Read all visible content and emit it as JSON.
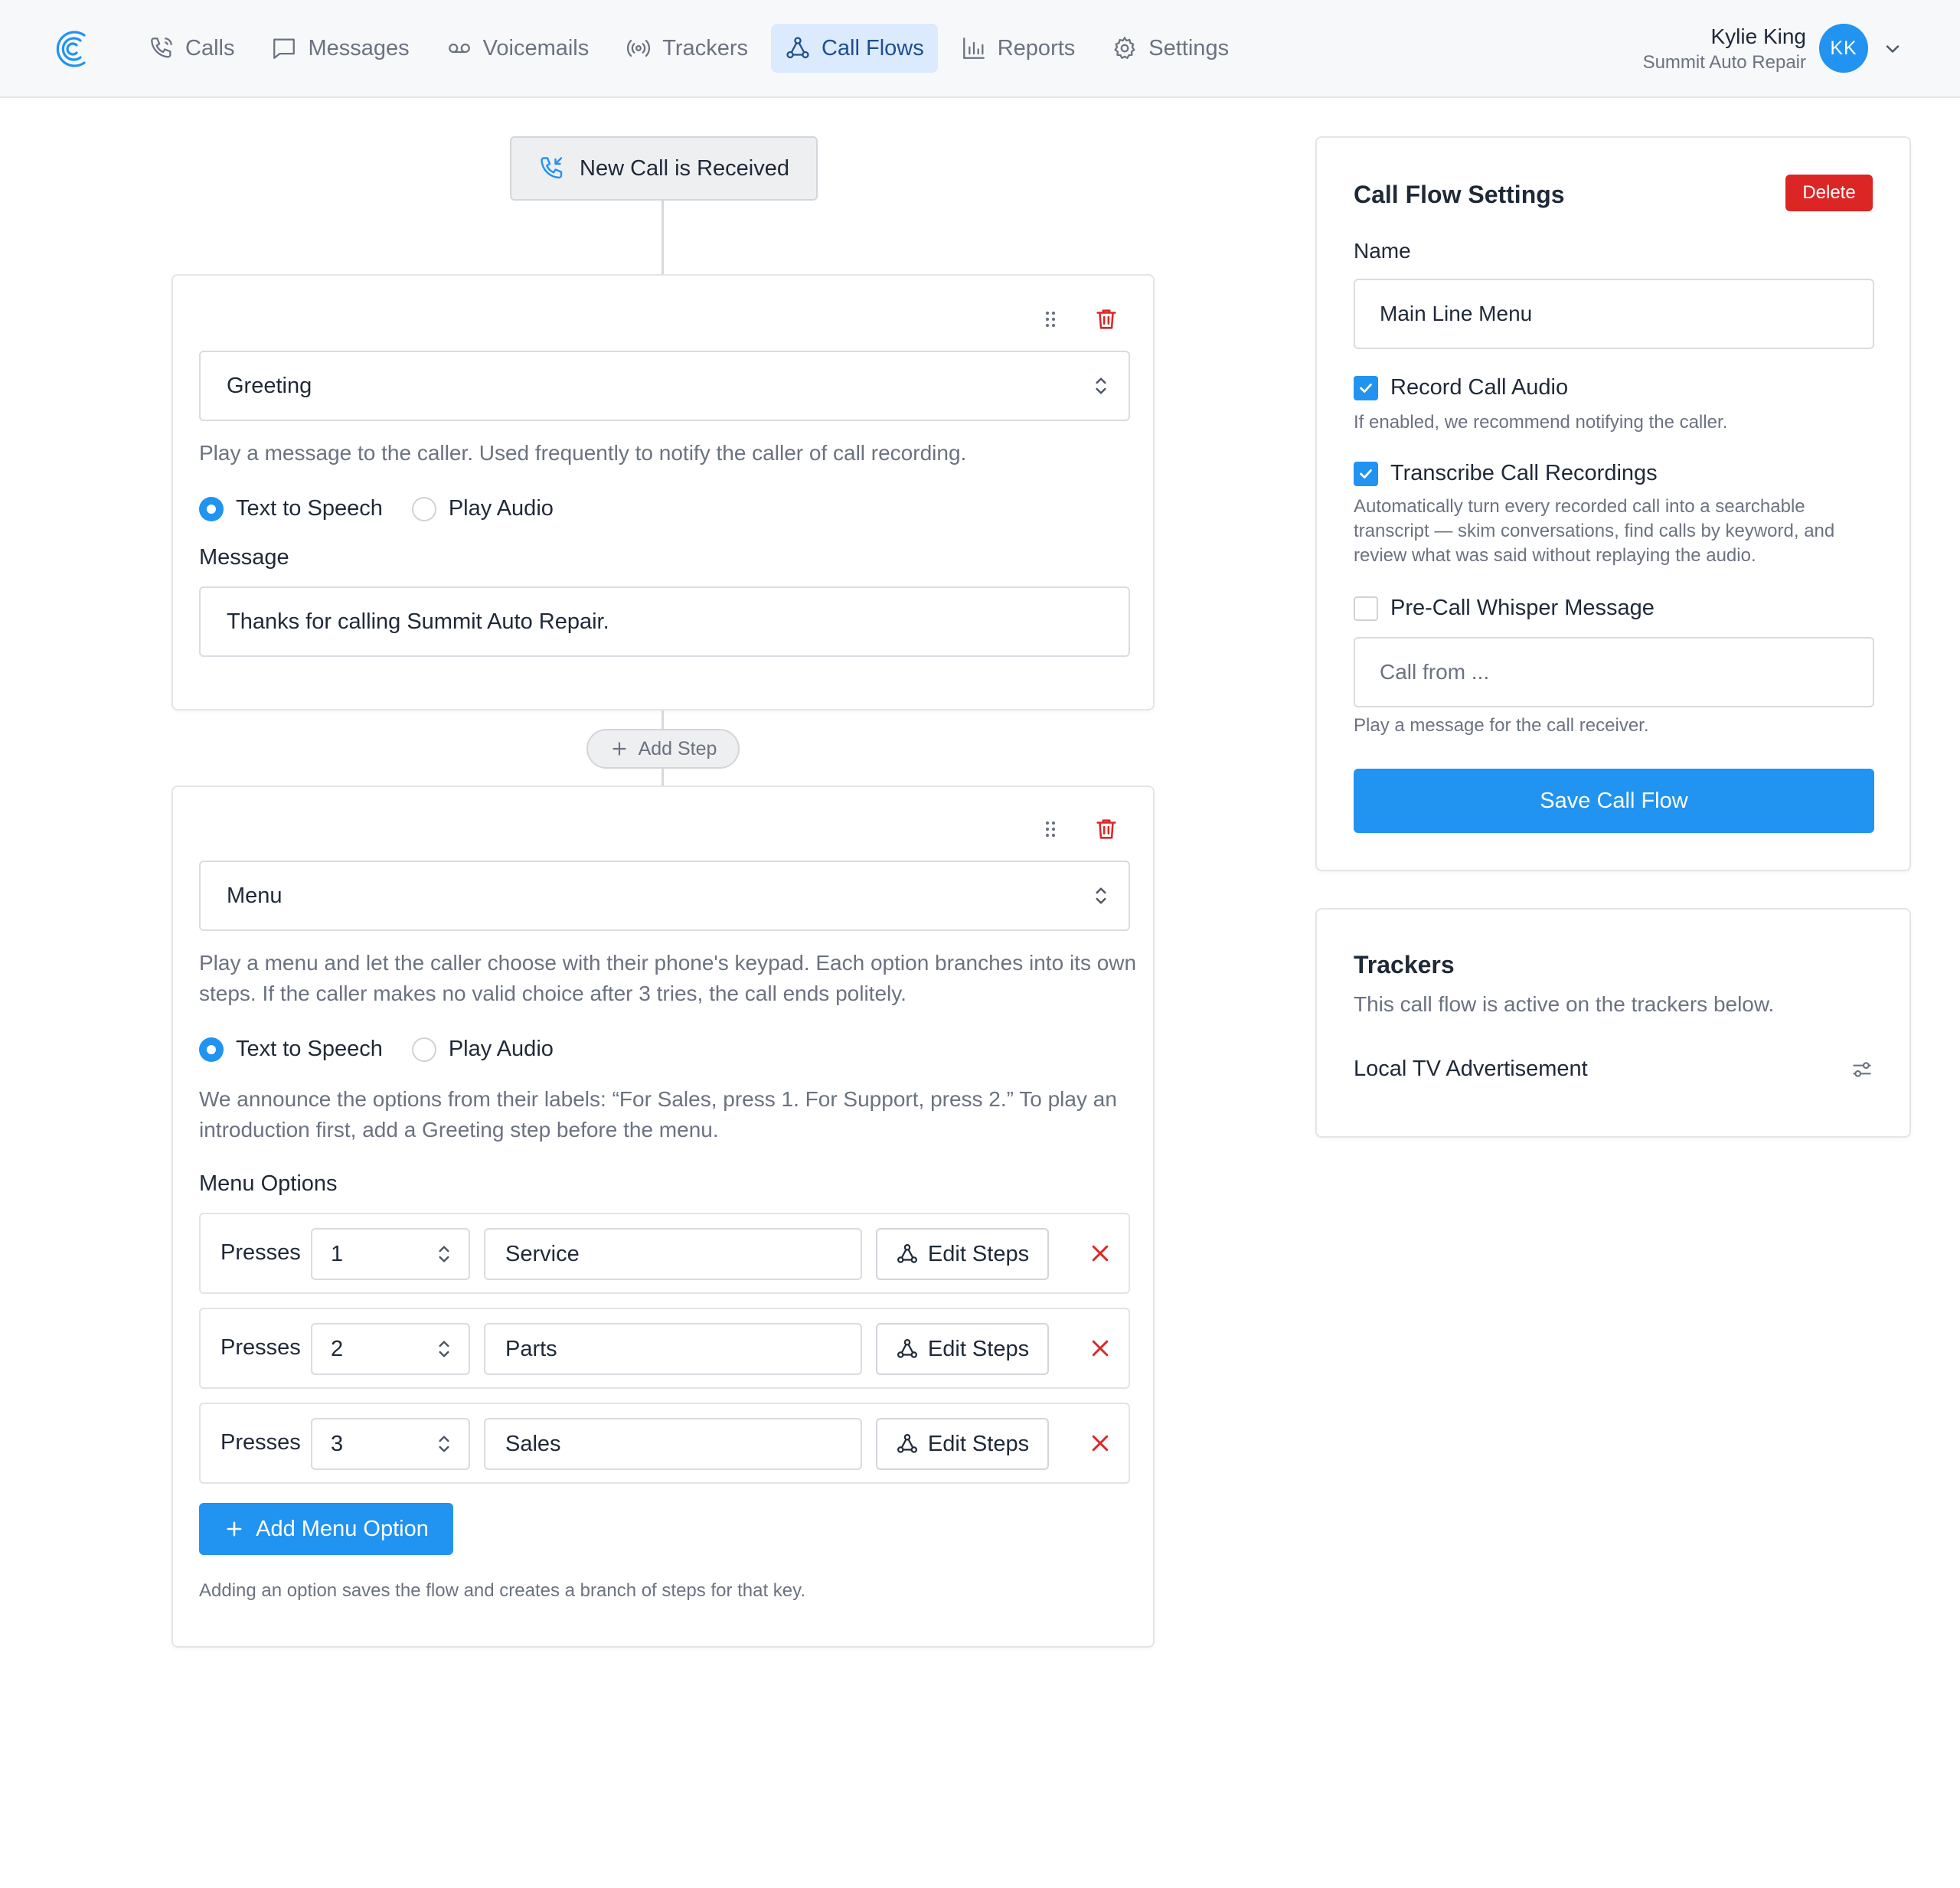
{
  "header": {
    "nav": [
      {
        "label": "Calls",
        "icon": "phone-icon"
      },
      {
        "label": "Messages",
        "icon": "message-icon"
      },
      {
        "label": "Voicemails",
        "icon": "voicemail-icon"
      },
      {
        "label": "Trackers",
        "icon": "broadcast-icon"
      },
      {
        "label": "Call Flows",
        "icon": "flow-icon",
        "active": true
      },
      {
        "label": "Reports",
        "icon": "bar-chart-icon"
      },
      {
        "label": "Settings",
        "icon": "gear-icon"
      }
    ],
    "user": {
      "name": "Kylie King",
      "company": "Summit Auto Repair",
      "initials": "KK"
    }
  },
  "flow": {
    "start_node": "New Call is Received",
    "greeting_step": {
      "type": "Greeting",
      "description": "Play a message to the caller. Used frequently to notify the caller of call recording.",
      "radio_tts": "Text to Speech",
      "radio_audio": "Play Audio",
      "selected": "tts",
      "message_label": "Message",
      "message_value": "Thanks for calling Summit Auto Repair."
    },
    "add_step_label": "Add Step",
    "menu_step": {
      "type": "Menu",
      "description": "Play a menu and let the caller choose with their phone's keypad. Each option branches into its own steps. If the caller makes no valid choice after 3 tries, the call ends politely.",
      "radio_tts": "Text to Speech",
      "radio_audio": "Play Audio",
      "selected": "tts",
      "announce_help": "We announce the options from their labels: “For Sales, press 1. For Support, press 2.” To play an introduction first, add a Greeting step before the menu.",
      "options_label": "Menu Options",
      "presses_label": "Presses",
      "edit_steps_label": "Edit Steps",
      "options": [
        {
          "key": "1",
          "label": "Service"
        },
        {
          "key": "2",
          "label": "Parts"
        },
        {
          "key": "3",
          "label": "Sales"
        }
      ],
      "add_option_label": "Add Menu Option",
      "add_option_help": "Adding an option saves the flow and creates a branch of steps for that key."
    }
  },
  "settings": {
    "title": "Call Flow Settings",
    "delete_label": "Delete",
    "name_label": "Name",
    "name_value": "Main Line Menu",
    "record": {
      "label": "Record Call Audio",
      "checked": true,
      "help": "If enabled, we recommend notifying the caller."
    },
    "transcribe": {
      "label": "Transcribe Call Recordings",
      "checked": true,
      "help": "Automatically turn every recorded call into a searchable transcript — skim conversations, find calls by keyword, and review what was said without replaying the audio."
    },
    "whisper": {
      "label": "Pre-Call Whisper Message",
      "checked": false,
      "placeholder": "Call from ...",
      "help": "Play a message for the call receiver."
    },
    "save_label": "Save Call Flow"
  },
  "trackers": {
    "title": "Trackers",
    "subtitle": "This call flow is active on the trackers below.",
    "items": [
      {
        "name": "Local TV Advertisement"
      }
    ]
  },
  "colors": {
    "accent": "#2193f0",
    "danger": "#dc2626",
    "active_nav_bg": "#dbeafd"
  }
}
